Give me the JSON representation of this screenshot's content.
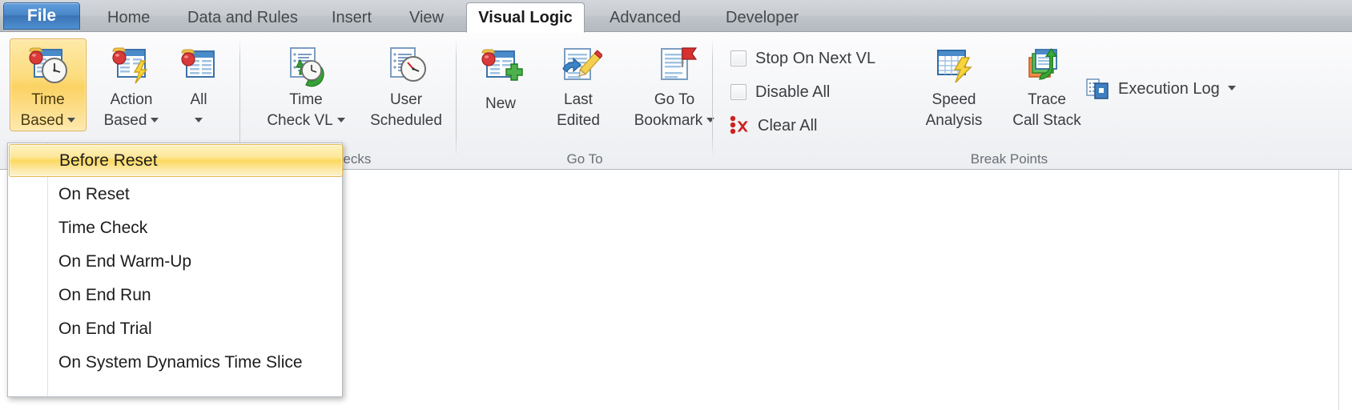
{
  "window": {
    "tabs": [
      {
        "label": "File",
        "state": "file"
      },
      {
        "label": "Home",
        "state": "normal"
      },
      {
        "label": "Data and Rules",
        "state": "normal"
      },
      {
        "label": "Insert",
        "state": "normal"
      },
      {
        "label": "View",
        "state": "normal"
      },
      {
        "label": "Visual Logic",
        "state": "active"
      },
      {
        "label": "Advanced",
        "state": "normal"
      },
      {
        "label": "Developer",
        "state": "normal"
      }
    ]
  },
  "ribbon": {
    "groups": [
      {
        "name": "logic",
        "label": ""
      },
      {
        "name": "checks",
        "label": "Checks"
      },
      {
        "name": "goto",
        "label": "Go To"
      },
      {
        "name": "breakpoints",
        "label": "Break Points"
      }
    ],
    "buttons": {
      "time_based": {
        "line1": "Time",
        "line2": "Based",
        "icon": "table-clock-icon",
        "has_caret": true,
        "selected": true
      },
      "action_based": {
        "line1": "Action",
        "line2": "Based",
        "icon": "table-lightning-icon",
        "has_caret": true,
        "selected": false
      },
      "all": {
        "line1": "All",
        "line2": "",
        "icon": "table-icon",
        "has_caret": true,
        "selected": false
      },
      "time_check_vl": {
        "line1": "Time",
        "line2": "Check VL",
        "icon": "document-refresh-clock-icon",
        "has_caret": true,
        "selected": false
      },
      "user_scheduled": {
        "line1": "User",
        "line2": "Scheduled",
        "icon": "document-clock-icon",
        "has_caret": false,
        "selected": false
      },
      "new": {
        "line1": "New",
        "line2": "",
        "icon": "table-plus-icon",
        "has_caret": false,
        "selected": false
      },
      "last_edited": {
        "line1": "Last",
        "line2": "Edited",
        "icon": "document-pencil-icon",
        "has_caret": false,
        "selected": false
      },
      "go_to_bookmark": {
        "line1": "Go To",
        "line2": "Bookmark",
        "icon": "document-flag-icon",
        "has_caret": true,
        "selected": false
      },
      "speed_analysis": {
        "line1": "Speed",
        "line2": "Analysis",
        "icon": "grid-lightning-icon",
        "has_caret": false,
        "selected": false
      },
      "trace_call_stack": {
        "line1": "Trace",
        "line2": "Call Stack",
        "icon": "stack-arrow-icon",
        "has_caret": false,
        "selected": false
      }
    },
    "checkboxes": [
      {
        "label": "Stop On Next VL",
        "checked": false
      },
      {
        "label": "Disable All",
        "checked": false
      }
    ],
    "clear_all": {
      "label": "Clear All",
      "icon": "breakpoint-clear-icon"
    },
    "execution_log": {
      "label": "Execution Log",
      "icon": "execution-log-icon",
      "has_caret": true
    }
  },
  "menu": {
    "items": [
      {
        "label": "Before Reset",
        "highlighted": true
      },
      {
        "label": "On Reset",
        "highlighted": false
      },
      {
        "label": "Time Check",
        "highlighted": false
      },
      {
        "label": "On End Warm-Up",
        "highlighted": false
      },
      {
        "label": "On End Run",
        "highlighted": false
      },
      {
        "label": "On End Trial",
        "highlighted": false
      },
      {
        "label": "On System Dynamics Time Slice",
        "highlighted": false
      }
    ]
  },
  "colors": {
    "file_tab_blue": "#4a87c8",
    "selected_gold": "#fbd263",
    "ribbon_bg": "#f3f4f6",
    "tabbar_bg": "#c8ccd1",
    "accent_red": "#cc2222",
    "accent_green": "#3f9f3f"
  }
}
